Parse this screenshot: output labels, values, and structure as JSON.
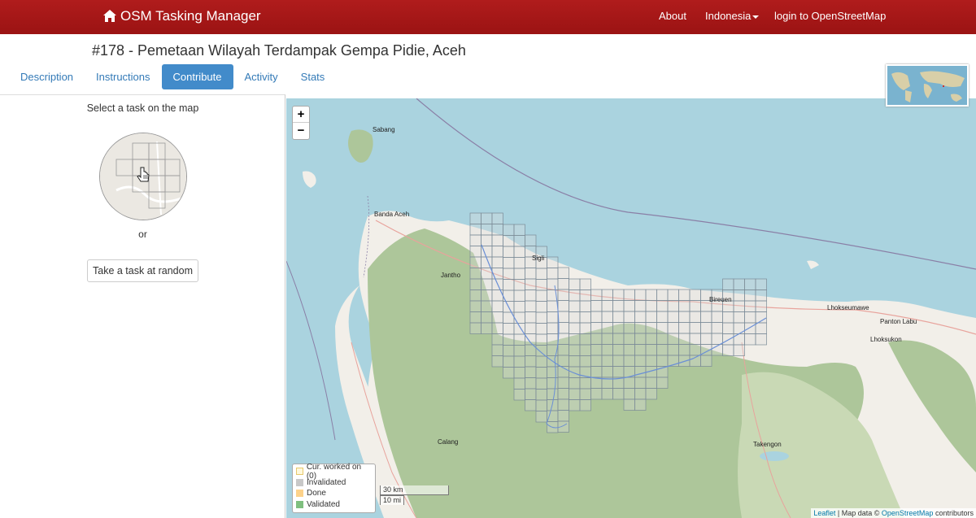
{
  "navbar": {
    "brand": "OSM Tasking Manager",
    "about": "About",
    "language": "Indonesia",
    "login": "login to OpenStreetMap"
  },
  "project": {
    "title": "#178 - Pemetaan Wilayah Terdampak Gempa Pidie, Aceh"
  },
  "tabs": [
    {
      "label": "Description",
      "active": false
    },
    {
      "label": "Instructions",
      "active": false
    },
    {
      "label": "Contribute",
      "active": true
    },
    {
      "label": "Activity",
      "active": false
    },
    {
      "label": "Stats",
      "active": false
    }
  ],
  "panel": {
    "heading": "Select a task on the map",
    "or": "or",
    "random_button": "Take a task at random"
  },
  "map": {
    "zoom_in": "+",
    "zoom_out": "−",
    "labels": {
      "sabang": "Sabang",
      "banda_aceh": "Banda Aceh",
      "jantho": "Jantho",
      "bireuen": "Bireuen",
      "lhokseumawe": "Lhokseumawe",
      "panton_labu": "Panton Labu",
      "lhoksukon": "Lhoksukon",
      "calang": "Calang",
      "takengon": "Takengon",
      "sigli": "Sigli"
    },
    "legend": [
      {
        "label": "Cur. worked on (0)",
        "color": "#fff8dc"
      },
      {
        "label": "Invalidated",
        "color": "#c8c8c8"
      },
      {
        "label": "Done",
        "color": "#fdd28a"
      },
      {
        "label": "Validated",
        "color": "#7fbf7f"
      }
    ],
    "scale": {
      "km": "30 km",
      "mi": "10 mi"
    },
    "attribution": {
      "leaflet": "Leaflet",
      "map_data": "Map data ©",
      "osm": "OpenStreetMap",
      "contributors": "contributors"
    }
  },
  "colors": {
    "navbar": "#a51717",
    "tab_active": "#428bca",
    "link": "#337ab7",
    "sea": "#aad3df",
    "land": "#f2efe9",
    "forest": "#adc69a",
    "grid": "#7a8a96"
  }
}
